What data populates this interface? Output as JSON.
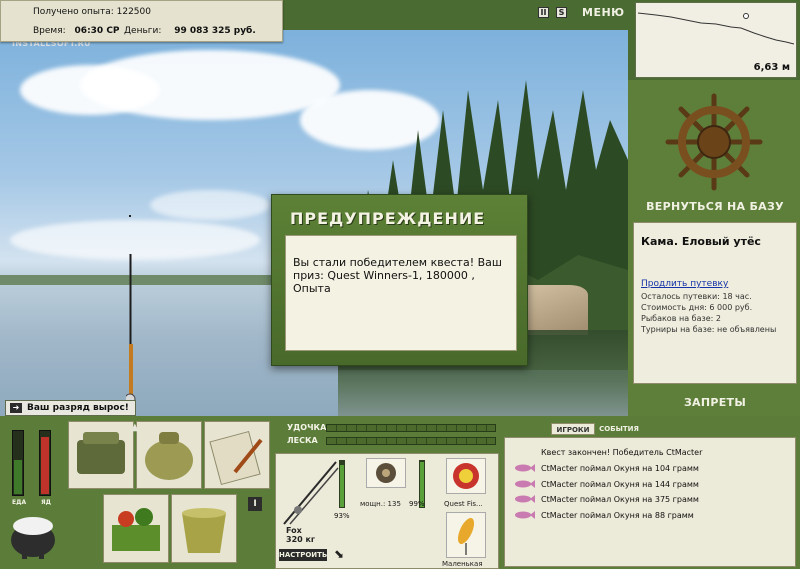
{
  "info": {
    "xp_label": "Получено опыта:",
    "xp_value": "122500",
    "time_label": "Время:",
    "time_value": "06:30 СР",
    "money_label": "Деньги:",
    "money_value": "99 083 325 руб."
  },
  "watermark": "INSTALLSOFT.RU",
  "top_controls": {
    "pause": "II",
    "sound": "S",
    "menu": "МЕНЮ"
  },
  "dialog": {
    "title": "ПРЕДУПРЕЖДЕНИЕ",
    "message": "Вы стали победителем квеста! Ваш приз: Quest Winners-1, 180000 , Опыта"
  },
  "rank_message": "Ваш разряд вырос!",
  "minimap": {
    "depth": "6,63 м"
  },
  "base": {
    "return_button": "ВЕРНУТЬСЯ НА БАЗУ",
    "name": "Кама. Еловый утёс",
    "extend_link": "Продлить путевку",
    "time_left": "Осталось путевки: 18 час.",
    "day_cost": "Стоимость дня: 6 000 руб.",
    "fishers": "Рыбаков на базе: 2",
    "tournaments": "Турниры на базе: не объявлены",
    "bans_button": "ЗАПРЕТЫ"
  },
  "meters": {
    "food_label": "ЕДА",
    "food_level": 0.55,
    "poison_label": "ЯД",
    "poison_level": 0.92
  },
  "tackle": {
    "rod_label": "УДОЧКА",
    "line_label": "ЛЕСКА",
    "rod_name": "Fox",
    "rod_weight": "320 кг",
    "rod_pct": "93%",
    "reel_name": "мощн.: 135",
    "reel_pct": "99%",
    "line_name": "Quest Fis...",
    "lure_name": "Маленькая",
    "setup_button": "НАСТРОИТЬ"
  },
  "chat": {
    "tab_players": "ИГРОКИ",
    "tab_events": "СОБЫТИЯ",
    "lines": [
      "Квест закончен! Победитель CtMacter",
      "CtMacter поймал Окуня на 104 грамм",
      "CtMacter поймал Окуня на 144 грамм",
      "CtMacter поймал Окуня на 375 грамм",
      "CtMacter поймал Окуня на 88 грамм"
    ]
  },
  "colors": {
    "ui_green": "#5c7d3a",
    "panel_cream": "#ecead8",
    "link_blue": "#1433a8"
  }
}
